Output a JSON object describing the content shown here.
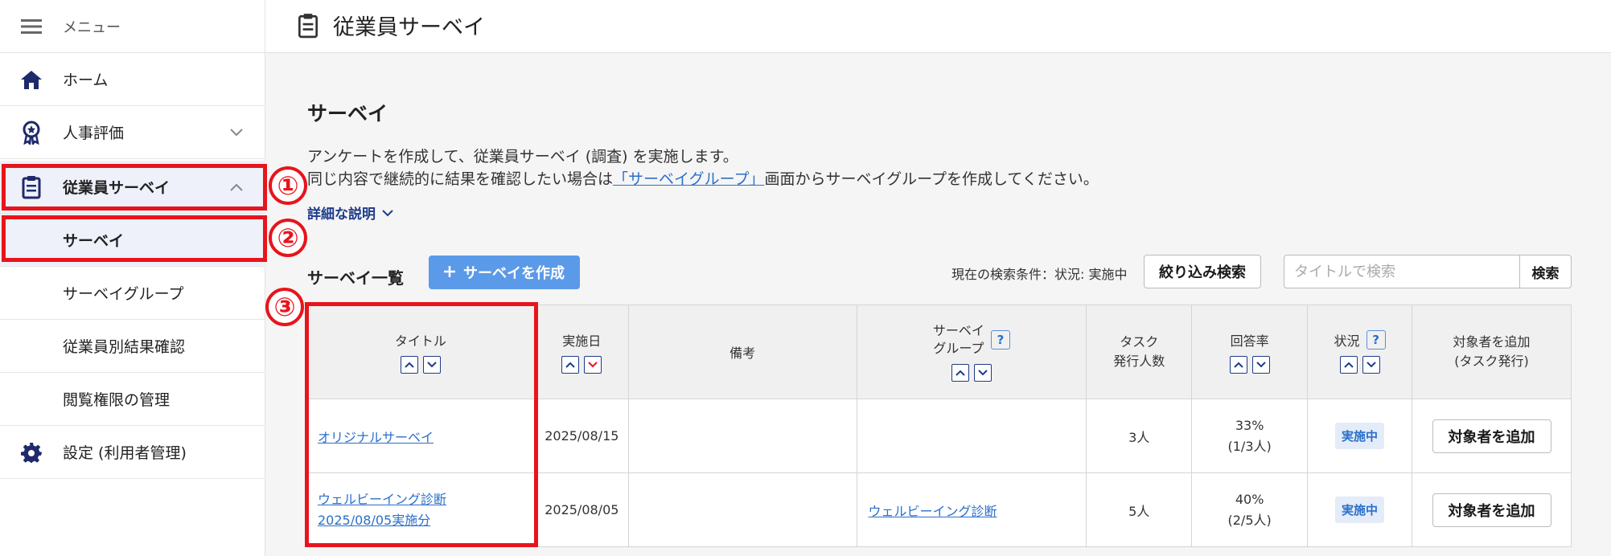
{
  "sidebar": {
    "menu_label": "メニュー",
    "items": [
      {
        "label": "ホーム"
      },
      {
        "label": "人事評価"
      },
      {
        "label": "従業員サーベイ"
      },
      {
        "label": "サーベイ"
      },
      {
        "label": "サーベイグループ"
      },
      {
        "label": "従業員別結果確認"
      },
      {
        "label": "閲覧権限の管理"
      },
      {
        "label": "設定 (利用者管理)"
      }
    ]
  },
  "header": {
    "title": "従業員サーベイ"
  },
  "page": {
    "title": "サーベイ",
    "desc1": "アンケートを作成して、従業員サーベイ (調査) を実施します。",
    "desc2_prefix": "同じ内容で継続的に結果を確認したい場合は",
    "desc2_link": "「サーベイグループ」",
    "desc2_suffix": "画面からサーベイグループを作成してください。",
    "detail_link": "詳細な説明"
  },
  "toolbar": {
    "list_title": "サーベイ一覧",
    "create_label": "サーベイを作成",
    "condition": "現在の検索条件：状況: 実施中",
    "filter_label": "絞り込み検索",
    "search_placeholder": "タイトルで検索",
    "search_label": "検索"
  },
  "table": {
    "headers": {
      "title": "タイトル",
      "date": "実施日",
      "note": "備考",
      "group_l1": "サーベイ",
      "group_l2": "グループ",
      "task_l1": "タスク",
      "task_l2": "発行人数",
      "rate": "回答率",
      "status": "状況",
      "add_l1": "対象者を追加",
      "add_l2": "(タスク発行)"
    },
    "help_label": "?",
    "rows": [
      {
        "title": "オリジナルサーベイ",
        "title_l2": "",
        "date": "2025/08/15",
        "note": "",
        "group": "",
        "count": "3人",
        "rate": "33%",
        "rate_detail": "(1/3人)",
        "status": "実施中",
        "add": "対象者を追加"
      },
      {
        "title": "ウェルビーイング診断",
        "title_l2": "2025/08/05実施分",
        "date": "2025/08/05",
        "note": "",
        "group": "ウェルビーイング診断",
        "count": "5人",
        "rate": "40%",
        "rate_detail": "(2/5人)",
        "status": "実施中",
        "add": "対象者を追加"
      }
    ]
  },
  "annotations": [
    "①",
    "②",
    "③"
  ],
  "colors": {
    "accent": "#5b9ae8",
    "highlight": "#e8141c",
    "nav_bg": "#eef1f9"
  }
}
